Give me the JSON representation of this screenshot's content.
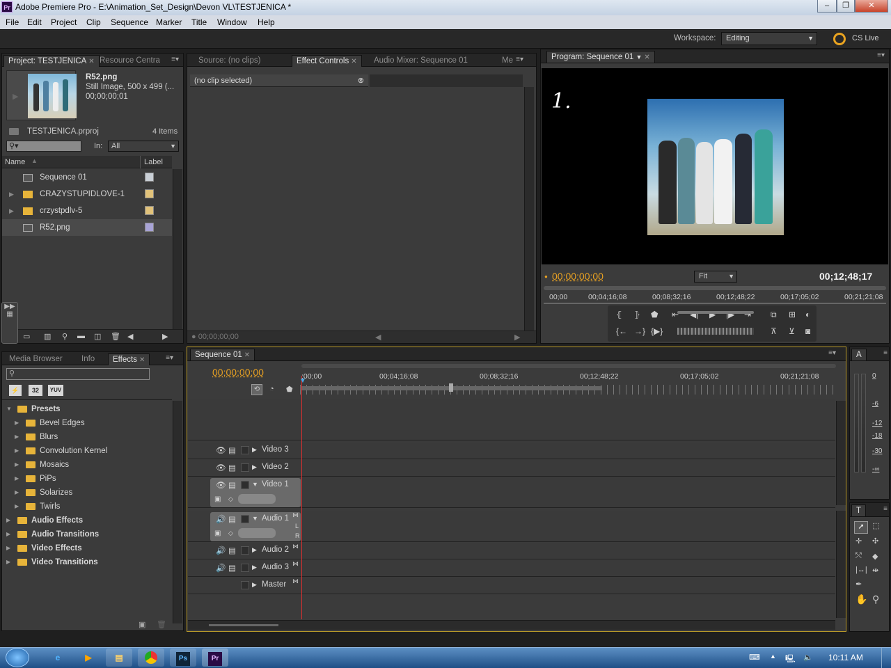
{
  "window": {
    "title": "Adobe Premiere Pro - E:\\Animation_Set_Design\\Devon VL\\TESTJENICA *",
    "app_icon": "Pr"
  },
  "menu": [
    "File",
    "Edit",
    "Project",
    "Clip",
    "Sequence",
    "Marker",
    "Title",
    "Window",
    "Help"
  ],
  "workspace": {
    "label": "Workspace:",
    "value": "Editing",
    "cslive": "CS Live"
  },
  "project": {
    "tabs": [
      "Project: TESTJENICA",
      "Resource Centra"
    ],
    "preview": {
      "name": "R52.png",
      "info": "Still Image, 500 x 499 (...",
      "duration": "00;00;00;01"
    },
    "file": "TESTJENICA.prproj",
    "count": "4 Items",
    "in_label": "In:",
    "in_value": "All",
    "headers": {
      "name": "Name",
      "label": "Label"
    },
    "items": [
      {
        "name": "Sequence 01",
        "color": "#c9cfd6",
        "icon": "sequence-icon"
      },
      {
        "name": "CRAZYSTUPIDLOVE-1",
        "color": "#e1c27a",
        "icon": "folder-icon"
      },
      {
        "name": "crzystpdlv-5",
        "color": "#e1c27a",
        "icon": "folder-icon"
      },
      {
        "name": "R52.png",
        "color": "#a8a3d6",
        "icon": "image-file-icon"
      }
    ]
  },
  "source": {
    "tabs": [
      "Source: (no clips)",
      "Effect Controls",
      "Audio Mixer: Sequence 01",
      "Me"
    ],
    "no_clip": "(no clip selected)",
    "timecode": "00;00;00;00"
  },
  "program": {
    "tab": "Program: Sequence 01",
    "timecode": "00;00;00;00",
    "duration": "00;12;48;17",
    "fit": "Fit",
    "ruler": [
      "00;00",
      "00;04;16;08",
      "00;08;32;16",
      "00;12;48;22",
      "00;17;05;02",
      "00;21;21;08"
    ],
    "drawing_text": "1."
  },
  "effects": {
    "tabs": [
      "Media Browser",
      "Info",
      "Effects"
    ],
    "buttons": [
      "32",
      "YUV"
    ],
    "items": [
      {
        "label": "Presets",
        "level": 0,
        "bold": true,
        "open": true
      },
      {
        "label": "Bevel Edges",
        "level": 1
      },
      {
        "label": "Blurs",
        "level": 1
      },
      {
        "label": "Convolution Kernel",
        "level": 1
      },
      {
        "label": "Mosaics",
        "level": 1
      },
      {
        "label": "PiPs",
        "level": 1
      },
      {
        "label": "Solarizes",
        "level": 1
      },
      {
        "label": "Twirls",
        "level": 1
      },
      {
        "label": "Audio Effects",
        "level": 0,
        "bold": true
      },
      {
        "label": "Audio Transitions",
        "level": 0,
        "bold": true
      },
      {
        "label": "Video Effects",
        "level": 0,
        "bold": true
      },
      {
        "label": "Video Transitions",
        "level": 0,
        "bold": true
      }
    ]
  },
  "timeline": {
    "tab": "Sequence 01",
    "timecode": "00;00;00;00",
    "ruler": [
      ":00;00",
      "00;04;16;08",
      "00;08;32;16",
      "00;12;48;22",
      "00;17;05;02",
      "00;21;21;08"
    ],
    "tracks": [
      "Video 3",
      "Video 2",
      "Video 1",
      "Audio 1",
      "Audio 2",
      "Audio 3",
      "Master"
    ],
    "audio_lr": [
      "L",
      "R"
    ]
  },
  "meters": {
    "title": "A",
    "labels": [
      "0",
      "-6",
      "-12",
      "-18",
      "-30",
      "-∞"
    ]
  },
  "tools": {
    "title": "T"
  },
  "taskbar": {
    "clock": "10:11 AM",
    "apps": [
      "ie-icon",
      "media-player-icon",
      "explorer-icon",
      "chrome-icon",
      "Ps",
      "Pr"
    ]
  }
}
